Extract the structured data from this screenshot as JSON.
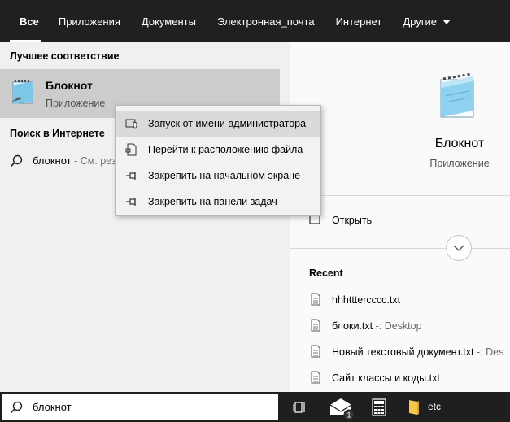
{
  "tabs": [
    {
      "label": "Все"
    },
    {
      "label": "Приложения"
    },
    {
      "label": "Документы"
    },
    {
      "label": "Электронная_почта"
    },
    {
      "label": "Интернет"
    },
    {
      "label": "Другие"
    }
  ],
  "left": {
    "best_match_heading": "Лучшее соответствие",
    "best_match_title": "Блокнот",
    "best_match_subtitle": "Приложение",
    "web_heading": "Поиск в Интернете",
    "web_query": "блокнот",
    "web_hint": " - См. рез"
  },
  "context_menu": {
    "items": [
      {
        "label": "Запуск от имени администратора",
        "icon": "shield-icon"
      },
      {
        "label": "Перейти к расположению файла",
        "icon": "file-location-icon"
      },
      {
        "label": "Закрепить на начальном экране",
        "icon": "pin-icon"
      },
      {
        "label": "Закрепить на панели задач",
        "icon": "pin-icon"
      }
    ]
  },
  "right": {
    "app_title": "Блокнот",
    "app_subtitle": "Приложение",
    "open_label": "Открыть",
    "recent_heading": "Recent",
    "recent": [
      {
        "name": "hhhttterccсс.txt",
        "path": ""
      },
      {
        "name": "блоки.txt",
        "path": " -: Desktop"
      },
      {
        "name": "Новый текстовый документ.txt",
        "path": " -: Des"
      },
      {
        "name": "Сайт классы и коды.txt",
        "path": ""
      }
    ]
  },
  "search": {
    "value": "блокнот"
  },
  "taskbar": {
    "folder_label": "etc",
    "badge": "1"
  }
}
